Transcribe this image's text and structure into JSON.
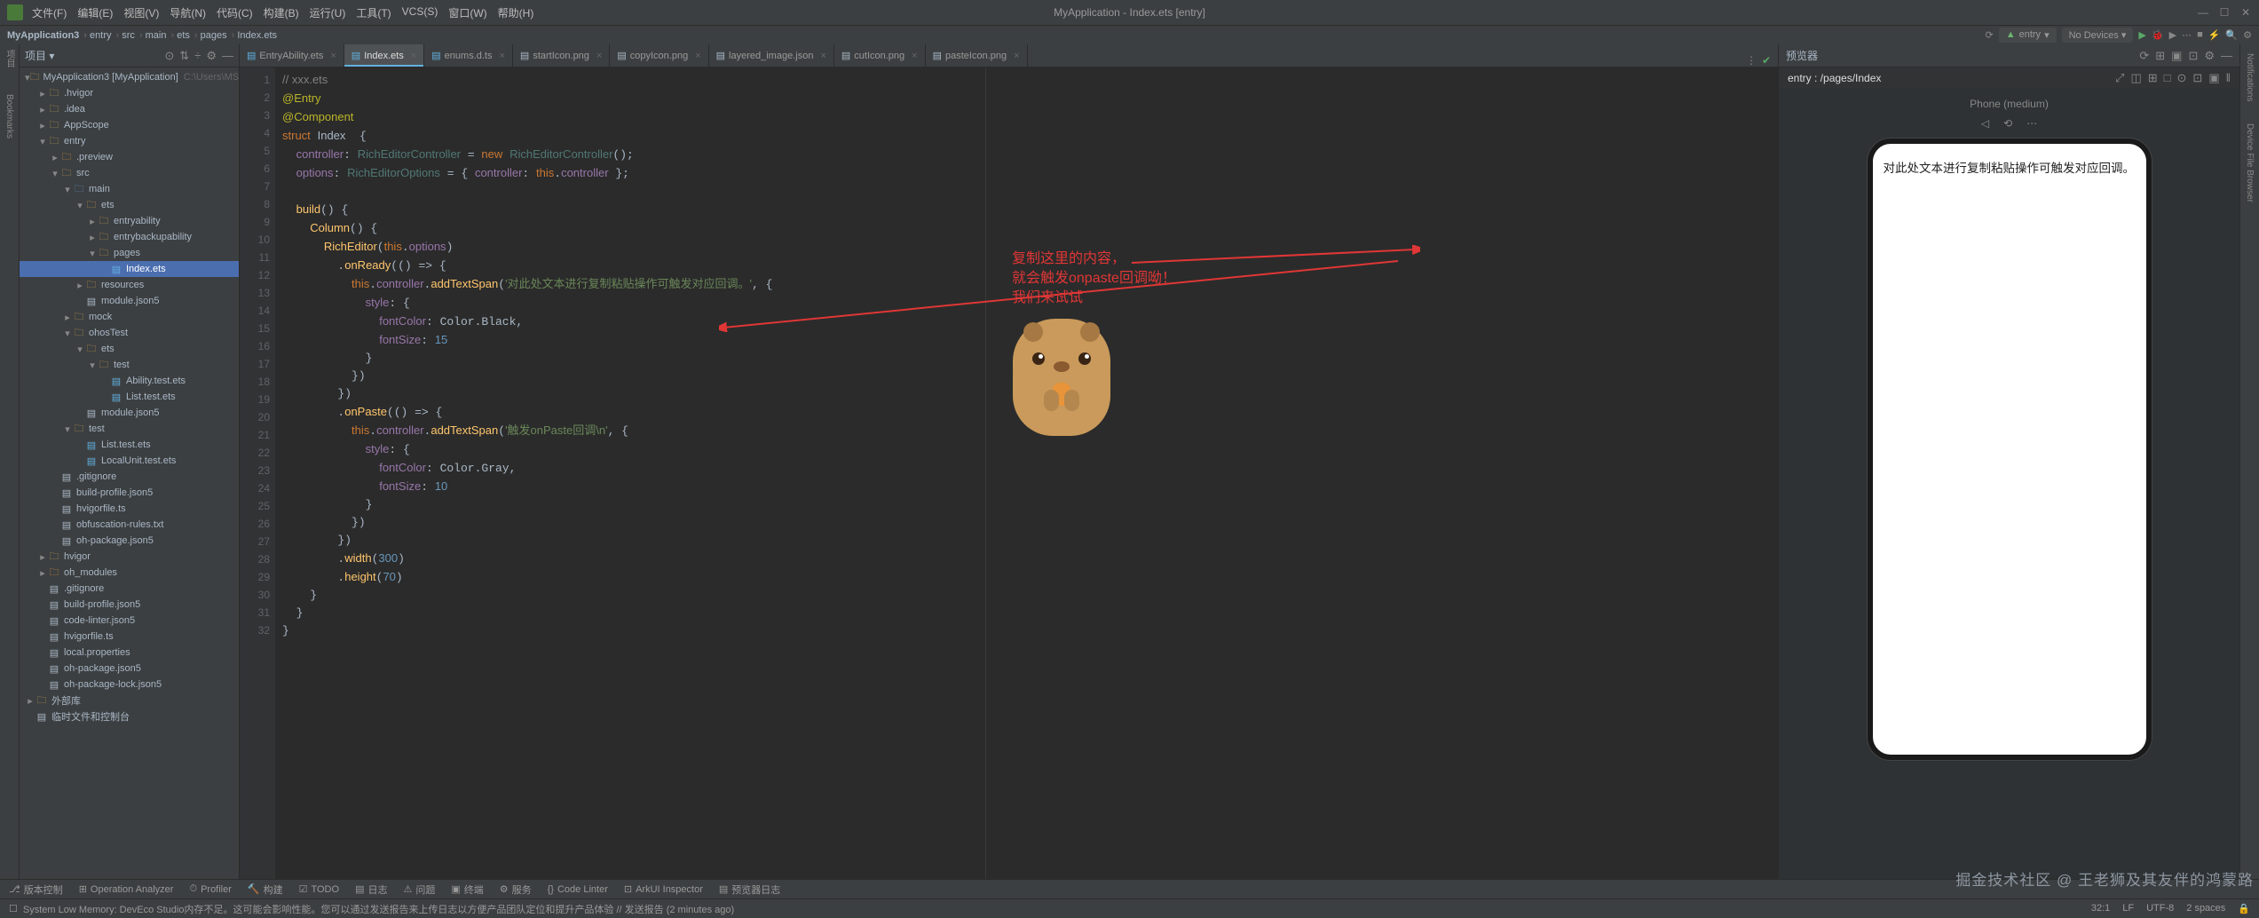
{
  "titlebar": {
    "menus": [
      "文件(F)",
      "编辑(E)",
      "视图(V)",
      "导航(N)",
      "代码(C)",
      "构建(B)",
      "运行(U)",
      "工具(T)",
      "VCS(S)",
      "窗口(W)",
      "帮助(H)"
    ],
    "title": "MyApplication - Index.ets [entry]",
    "winbtns": {
      "min": "—",
      "max": "☐",
      "close": "✕"
    }
  },
  "breadcrumb": [
    "MyApplication3",
    "entry",
    "src",
    "main",
    "ets",
    "pages",
    "Index.ets"
  ],
  "run_toolbar": {
    "entry_config": "entry",
    "devices": "No Devices ▾"
  },
  "project": {
    "title": "项目 ▾",
    "tree": [
      {
        "d": 0,
        "ch": "▾",
        "ic": "folder-ic",
        "l": "MyApplication3 [MyApplication]",
        "dim": "C:\\Users\\MSN\\DevEco"
      },
      {
        "d": 1,
        "ch": "▸",
        "ic": "folder-ic",
        "l": ".hvigor"
      },
      {
        "d": 1,
        "ch": "▸",
        "ic": "folder-ic",
        "l": ".idea"
      },
      {
        "d": 1,
        "ch": "▸",
        "ic": "folder-ic",
        "l": "AppScope"
      },
      {
        "d": 1,
        "ch": "▾",
        "ic": "folder-ic",
        "l": "entry"
      },
      {
        "d": 2,
        "ch": "▸",
        "ic": "folder-orange",
        "l": ".preview"
      },
      {
        "d": 2,
        "ch": "▾",
        "ic": "folder-ic",
        "l": "src"
      },
      {
        "d": 3,
        "ch": "▾",
        "ic": "folder-blue",
        "l": "main"
      },
      {
        "d": 4,
        "ch": "▾",
        "ic": "folder-ic",
        "l": "ets"
      },
      {
        "d": 5,
        "ch": "▸",
        "ic": "folder-ic",
        "l": "entryability"
      },
      {
        "d": 5,
        "ch": "▸",
        "ic": "folder-ic",
        "l": "entrybackupability"
      },
      {
        "d": 5,
        "ch": "▾",
        "ic": "folder-ic",
        "l": "pages"
      },
      {
        "d": 6,
        "ch": " ",
        "ic": "file-ets",
        "l": "Index.ets",
        "sel": true
      },
      {
        "d": 4,
        "ch": "▸",
        "ic": "folder-ic",
        "l": "resources"
      },
      {
        "d": 4,
        "ch": " ",
        "ic": "file-generic",
        "l": "module.json5"
      },
      {
        "d": 3,
        "ch": "▸",
        "ic": "folder-ic",
        "l": "mock"
      },
      {
        "d": 3,
        "ch": "▾",
        "ic": "folder-ic",
        "l": "ohosTest"
      },
      {
        "d": 4,
        "ch": "▾",
        "ic": "folder-ic",
        "l": "ets"
      },
      {
        "d": 5,
        "ch": "▾",
        "ic": "folder-ic",
        "l": "test"
      },
      {
        "d": 6,
        "ch": " ",
        "ic": "file-ets",
        "l": "Ability.test.ets"
      },
      {
        "d": 6,
        "ch": " ",
        "ic": "file-ets",
        "l": "List.test.ets"
      },
      {
        "d": 4,
        "ch": " ",
        "ic": "file-generic",
        "l": "module.json5"
      },
      {
        "d": 3,
        "ch": "▾",
        "ic": "folder-ic",
        "l": "test"
      },
      {
        "d": 4,
        "ch": " ",
        "ic": "file-ets",
        "l": "List.test.ets"
      },
      {
        "d": 4,
        "ch": " ",
        "ic": "file-ets",
        "l": "LocalUnit.test.ets"
      },
      {
        "d": 2,
        "ch": " ",
        "ic": "file-generic",
        "l": ".gitignore"
      },
      {
        "d": 2,
        "ch": " ",
        "ic": "file-generic",
        "l": "build-profile.json5"
      },
      {
        "d": 2,
        "ch": " ",
        "ic": "file-generic",
        "l": "hvigorfile.ts"
      },
      {
        "d": 2,
        "ch": " ",
        "ic": "file-generic",
        "l": "obfuscation-rules.txt"
      },
      {
        "d": 2,
        "ch": " ",
        "ic": "file-generic",
        "l": "oh-package.json5"
      },
      {
        "d": 1,
        "ch": "▸",
        "ic": "folder-ic",
        "l": "hvigor"
      },
      {
        "d": 1,
        "ch": "▸",
        "ic": "folder-orange",
        "l": "oh_modules"
      },
      {
        "d": 1,
        "ch": " ",
        "ic": "file-generic",
        "l": ".gitignore"
      },
      {
        "d": 1,
        "ch": " ",
        "ic": "file-generic",
        "l": "build-profile.json5"
      },
      {
        "d": 1,
        "ch": " ",
        "ic": "file-generic",
        "l": "code-linter.json5"
      },
      {
        "d": 1,
        "ch": " ",
        "ic": "file-generic",
        "l": "hvigorfile.ts"
      },
      {
        "d": 1,
        "ch": " ",
        "ic": "file-generic",
        "l": "local.properties"
      },
      {
        "d": 1,
        "ch": " ",
        "ic": "file-generic",
        "l": "oh-package.json5"
      },
      {
        "d": 1,
        "ch": " ",
        "ic": "file-generic",
        "l": "oh-package-lock.json5"
      },
      {
        "d": 0,
        "ch": "▸",
        "ic": "folder-ic",
        "l": "外部库"
      },
      {
        "d": 0,
        "ch": " ",
        "ic": "file-generic",
        "l": "临时文件和控制台"
      }
    ]
  },
  "tabs": [
    {
      "ic": "file-ets",
      "l": "EntryAbility.ets"
    },
    {
      "ic": "file-ets",
      "l": "Index.ets",
      "active": true
    },
    {
      "ic": "file-ets",
      "l": "enums.d.ts"
    },
    {
      "ic": "file-generic",
      "l": "startIcon.png"
    },
    {
      "ic": "file-generic",
      "l": "copyIcon.png"
    },
    {
      "ic": "file-generic",
      "l": "layered_image.json"
    },
    {
      "ic": "file-generic",
      "l": "cutIcon.png"
    },
    {
      "ic": "file-generic",
      "l": "pasteIcon.png"
    }
  ],
  "code": {
    "lines": [
      "1",
      "2",
      "3",
      "4",
      "5",
      "6",
      "7",
      "8",
      "9",
      "10",
      "11",
      "12",
      "13",
      "14",
      "15",
      "16",
      "17",
      "18",
      "19",
      "20",
      "21",
      "22",
      "23",
      "24",
      "25",
      "26",
      "27",
      "28",
      "29",
      "30",
      "31",
      "32"
    ]
  },
  "annotation": {
    "l1": "复制这里的内容，",
    "l2": "就会触发onpaste回调呦！",
    "l3": "我们来试试"
  },
  "preview": {
    "title": "预览器",
    "path": "entry : /pages/Index",
    "device": "Phone (medium)",
    "text": "对此处文本进行复制粘贴操作可触发对应回调。"
  },
  "bottom_tools": [
    "版本控制",
    "Operation Analyzer",
    "Profiler",
    "构建",
    "TODO",
    "日志",
    "问题",
    "终端",
    "服务",
    "Code Linter",
    "ArkUI Inspector",
    "预览器日志"
  ],
  "status": {
    "msg": "System Low Memory: DevEco Studio内存不足。这可能会影响性能。您可以通过发送报告来上传日志以方便产品团队定位和提升产品体验 // 发送报告 (2 minutes ago)",
    "right": [
      "32:1",
      "LF",
      "UTF-8",
      "2 spaces"
    ]
  },
  "watermark": "掘金技术社区 @ 王老狮及其友伴的鸿蒙路"
}
